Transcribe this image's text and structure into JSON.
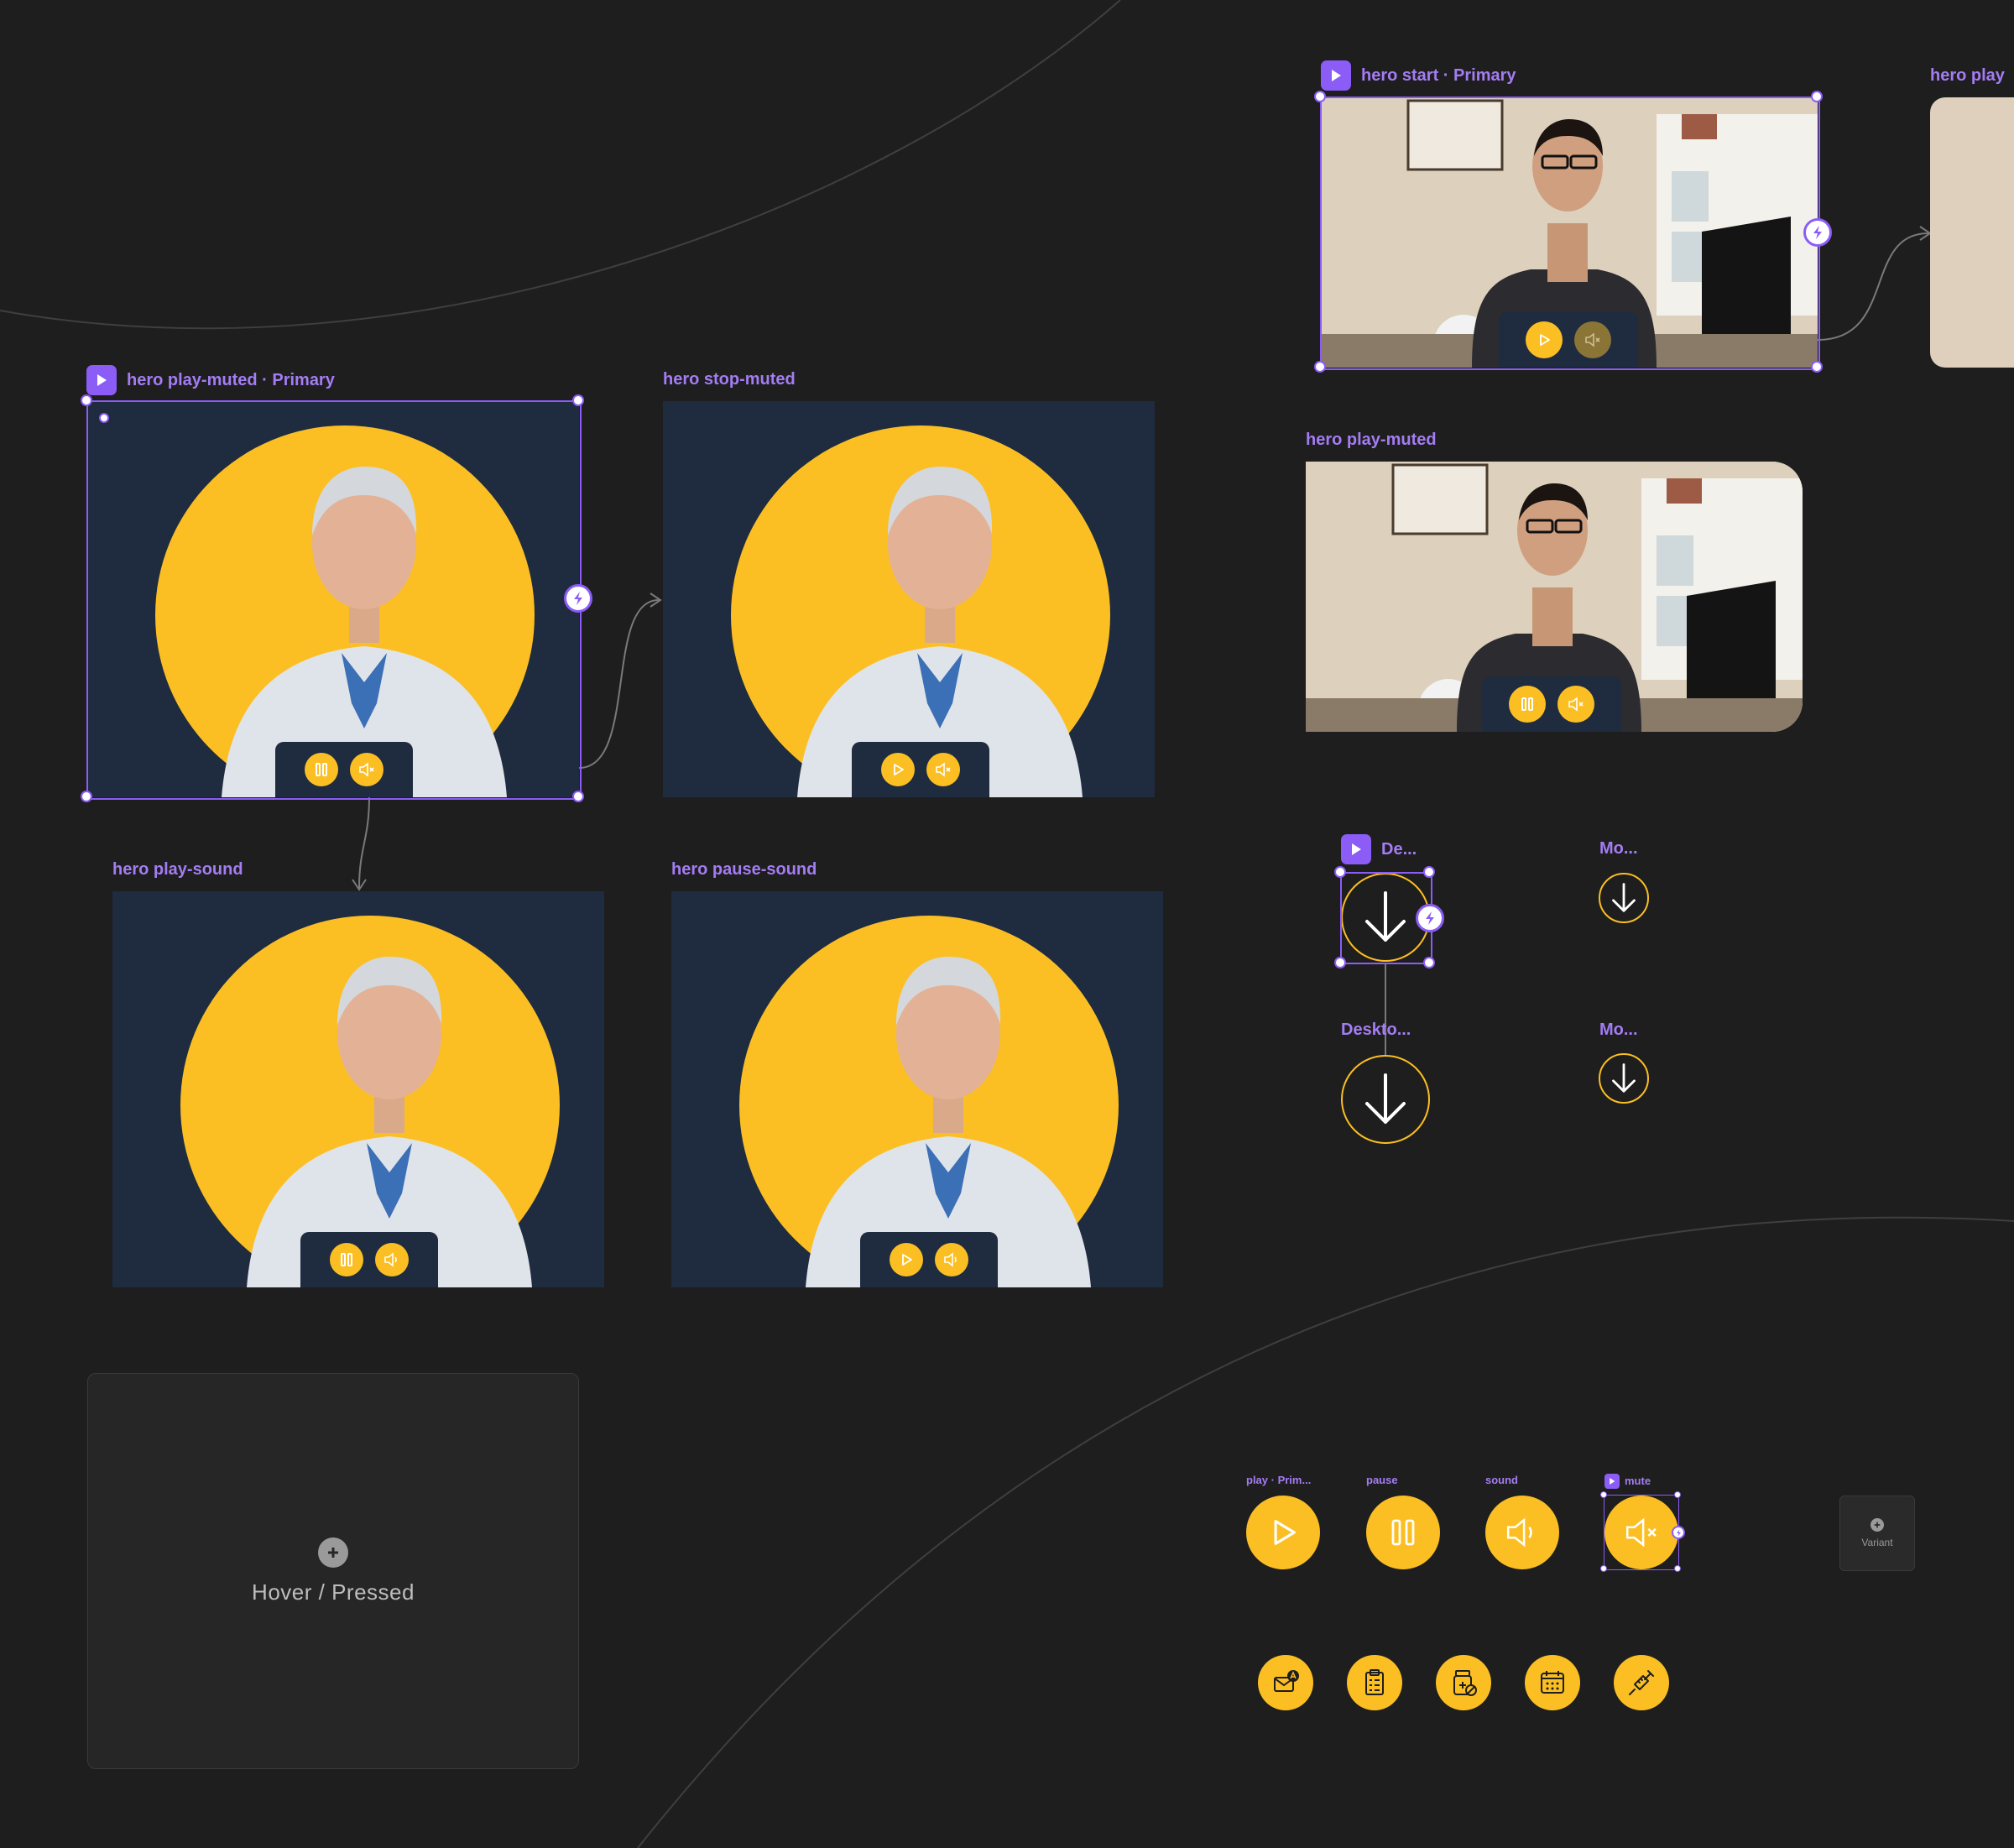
{
  "frames": {
    "hero_play_muted_primary": {
      "label": "hero play-muted · Primary"
    },
    "hero_stop_muted": {
      "label": "hero stop-muted"
    },
    "hero_play_sound": {
      "label": "hero play-sound"
    },
    "hero_pause_sound": {
      "label": "hero pause-sound"
    },
    "hero_start_primary": {
      "label": "hero start · Primary"
    },
    "hero_play": {
      "label": "hero play"
    },
    "hero_play_muted": {
      "label": "hero play-muted"
    }
  },
  "download_components": {
    "desktop_primary": {
      "label": "De..."
    },
    "mobile_1": {
      "label": "Mo..."
    },
    "desktop_2": {
      "label": "Deskto..."
    },
    "mobile_2": {
      "label": "Mo..."
    }
  },
  "placeholder_card": {
    "label": "Hover / Pressed"
  },
  "media_buttons": {
    "play": {
      "label": "play · Prim..."
    },
    "pause": {
      "label": "pause"
    },
    "sound": {
      "label": "sound"
    },
    "mute": {
      "label": "mute"
    }
  },
  "variant_card": {
    "label": "Variant"
  },
  "icon_row": [
    "mail-badge-icon",
    "clipboard-icon",
    "medicine-bottle-icon",
    "calendar-icon",
    "syringe-icon"
  ],
  "colors": {
    "canvas": "#1e1e1e",
    "accent_purple": "#8b5cf6",
    "label_purple": "#a47cf3",
    "brand_yellow": "#fbbf24",
    "navy": "#1f2b3e"
  }
}
